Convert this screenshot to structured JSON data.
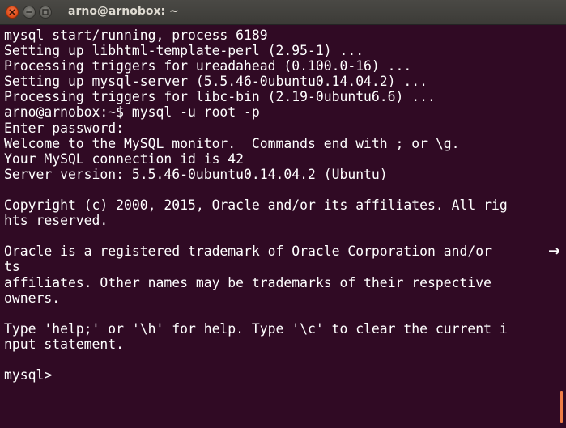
{
  "window": {
    "title": "arno@arnobox: ~"
  },
  "terminal": {
    "lines": [
      "mysql start/running, process 6189",
      "Setting up libhtml-template-perl (2.95-1) ...",
      "Processing triggers for ureadahead (0.100.0-16) ...",
      "Setting up mysql-server (5.5.46-0ubuntu0.14.04.2) ...",
      "Processing triggers for libc-bin (2.19-0ubuntu6.6) ...",
      "arno@arnobox:~$ mysql -u root -p",
      "Enter password:",
      "Welcome to the MySQL monitor.  Commands end with ; or \\g.",
      "Your MySQL connection id is 42",
      "Server version: 5.5.46-0ubuntu0.14.04.2 (Ubuntu)",
      "",
      "Copyright (c) 2000, 2015, Oracle and/or its affiliates. All rig",
      "hts reserved.",
      "",
      "Oracle is a registered trademark of Oracle Corporation and/or ",
      "ts",
      "affiliates. Other names may be trademarks of their respective",
      "owners.",
      "",
      "Type 'help;' or '\\h' for help. Type '\\c' to clear the current i",
      "nput statement.",
      "",
      "mysql> "
    ],
    "wrap_marker": "→"
  },
  "colors": {
    "background": "#300a24",
    "text": "#ffffff",
    "titlebar": "#3c3b37",
    "close_button": "#dd4814",
    "scroll_thumb": "#f07d46"
  },
  "icons": {
    "close": "close-icon",
    "minimize": "minimize-icon",
    "maximize": "maximize-icon"
  }
}
